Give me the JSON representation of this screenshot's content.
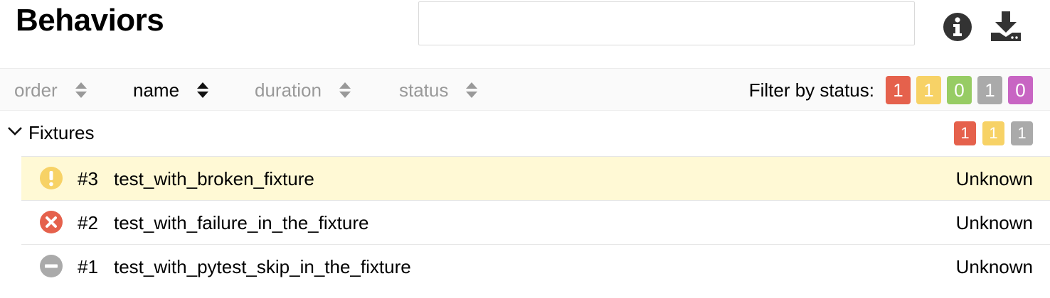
{
  "header": {
    "title": "Behaviors",
    "search": {
      "value": "",
      "placeholder": ""
    },
    "icons": {
      "info": "info-circle-icon",
      "download": "download-icon"
    }
  },
  "toolbar": {
    "sorters": [
      {
        "label": "order",
        "active": false
      },
      {
        "label": "name",
        "active": true
      },
      {
        "label": "duration",
        "active": false
      },
      {
        "label": "status",
        "active": false
      }
    ],
    "filter_label": "Filter by status:",
    "filters": [
      {
        "status": "failed",
        "count": "1",
        "color": "#e5614c"
      },
      {
        "status": "broken",
        "count": "1",
        "color": "#f7d266"
      },
      {
        "status": "passed",
        "count": "0",
        "color": "#97cc64"
      },
      {
        "status": "skipped",
        "count": "1",
        "color": "#aaaaaa"
      },
      {
        "status": "unknown",
        "count": "0",
        "color": "#c865c3"
      }
    ]
  },
  "group": {
    "name": "Fixtures",
    "badges": [
      {
        "status": "failed",
        "count": "1",
        "color": "#e5614c"
      },
      {
        "status": "broken",
        "count": "1",
        "color": "#f7d266"
      },
      {
        "status": "skipped",
        "count": "1",
        "color": "#aaaaaa"
      }
    ]
  },
  "rows": [
    {
      "order": "#3",
      "name": "test_with_broken_fixture",
      "status": "Unknown",
      "icon": "broken-icon",
      "selected": true
    },
    {
      "order": "#2",
      "name": "test_with_failure_in_the_fixture",
      "status": "Unknown",
      "icon": "failed-icon",
      "selected": false
    },
    {
      "order": "#1",
      "name": "test_with_pytest_skip_in_the_fixture",
      "status": "Unknown",
      "icon": "skipped-icon",
      "selected": false
    }
  ]
}
